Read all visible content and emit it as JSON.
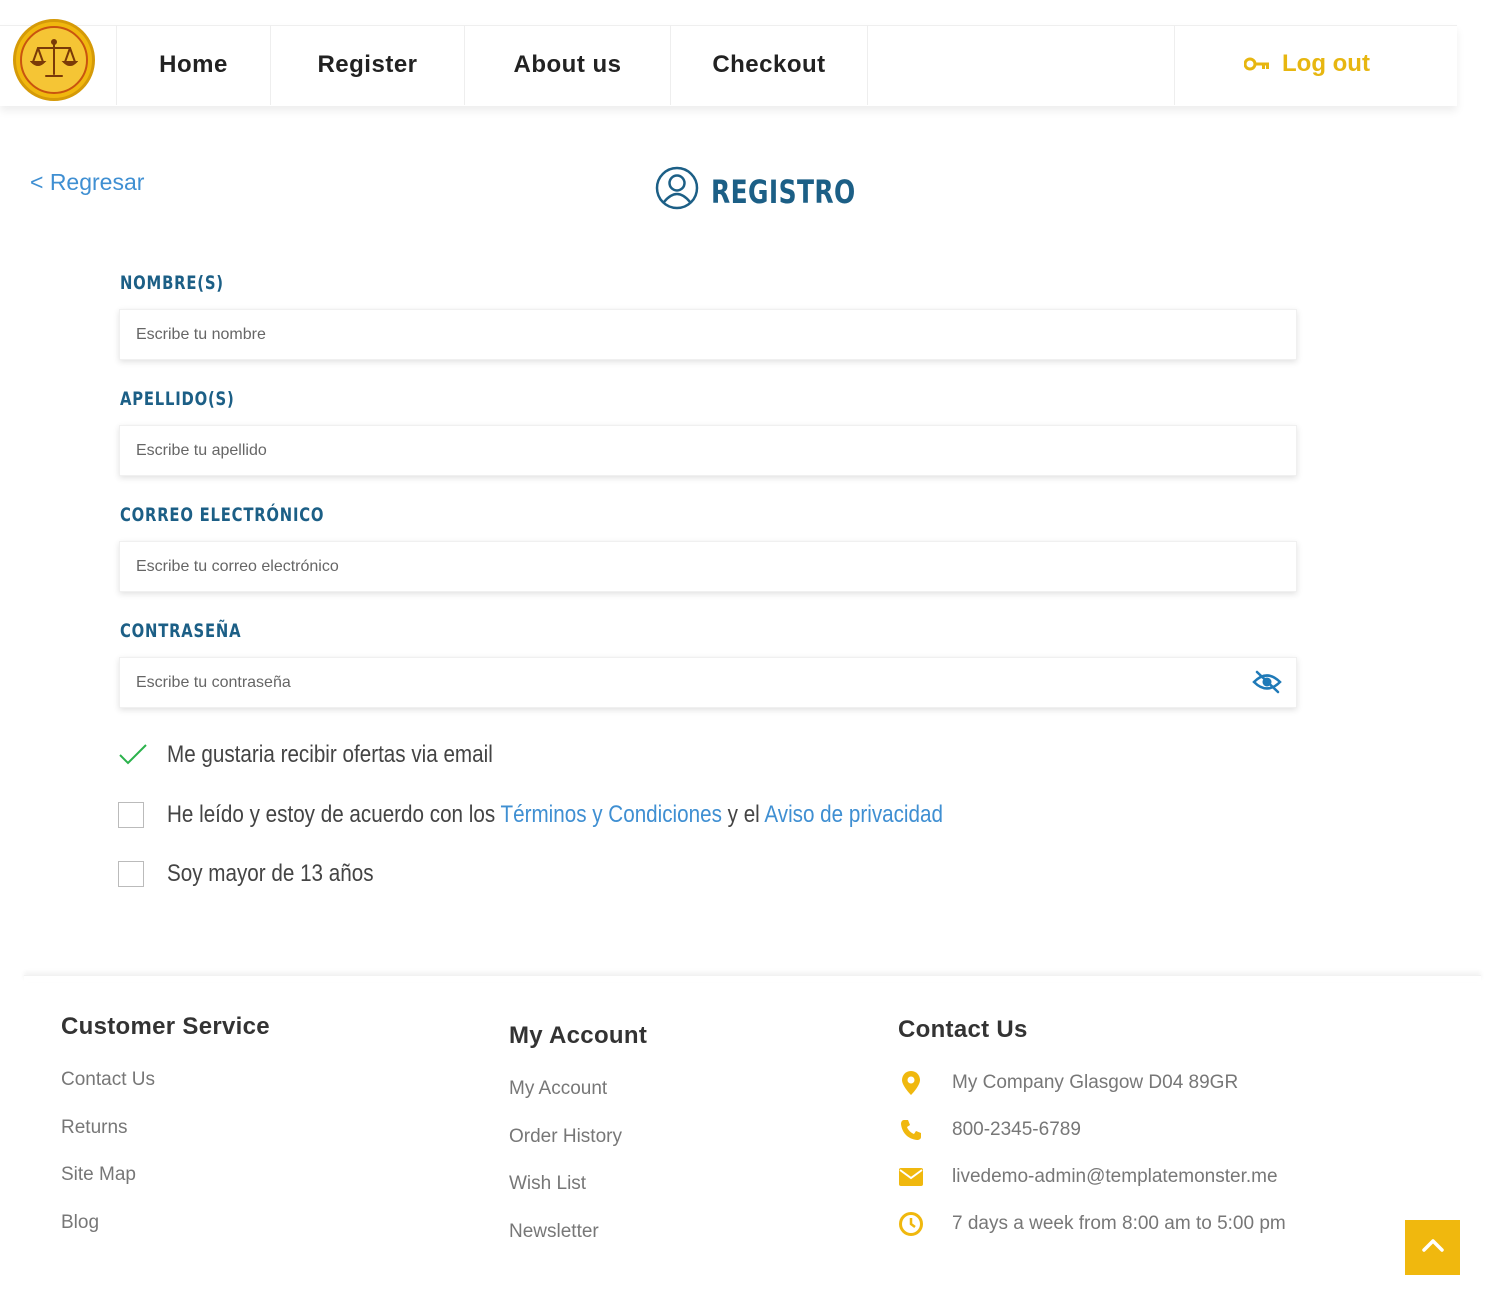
{
  "nav": {
    "items": [
      "Home",
      "Register",
      "About us",
      "Checkout"
    ],
    "logout_label": "Log out"
  },
  "page": {
    "back_label": "< Regresar",
    "title": "REGISTRO"
  },
  "form": {
    "name_label": "NOMBRE(S)",
    "name_placeholder": "Escribe tu nombre",
    "lastname_label": "APELLIDO(S)",
    "lastname_placeholder": "Escribe tu apellido",
    "email_label": "CORREO ELECTRÓNICO",
    "email_placeholder": "Escribe tu correo electrónico",
    "password_label": "CONTRASEÑA",
    "password_placeholder": "Escribe tu contraseña",
    "offers_label": "Me gustaria recibir ofertas via email",
    "offers_checked": true,
    "terms_prefix": "He leído y estoy de acuerdo con los ",
    "terms_link": "Términos y Condiciones",
    "terms_middle": " y el ",
    "privacy_link": "Aviso de privacidad",
    "terms_checked": false,
    "age_label": "Soy mayor de 13 años",
    "age_checked": false
  },
  "footer": {
    "customer_service": {
      "heading": "Customer Service",
      "links": [
        "Contact Us",
        "Returns",
        "Site Map",
        "Blog"
      ]
    },
    "my_account": {
      "heading": "My Account",
      "links": [
        "My Account",
        "Order History",
        "Wish List",
        "Newsletter"
      ]
    },
    "contact": {
      "heading": "Contact Us",
      "address": "My Company Glasgow D04 89GR",
      "phone": "800-2345-6789",
      "email": "livedemo-admin@templatemonster.me",
      "hours": "7 days a week from 8:00 am to 5:00 pm"
    }
  },
  "colors": {
    "accent": "#f0b80e",
    "heading_blue": "#1c5f86",
    "link_blue": "#3f8fd2",
    "check_green": "#2bb24c"
  },
  "icons": [
    "scales-logo-icon",
    "key-icon",
    "user-circle-icon",
    "eye-off-icon",
    "check-icon",
    "map-pin-icon",
    "phone-icon",
    "mail-icon",
    "clock-icon",
    "chevron-up-icon"
  ]
}
